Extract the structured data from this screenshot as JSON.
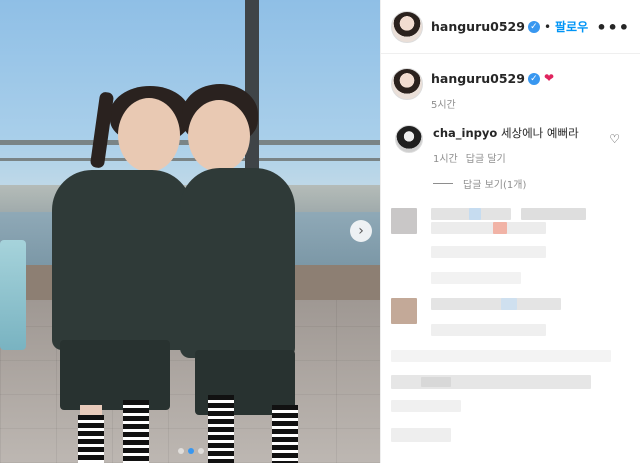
{
  "post": {
    "author": "hanguru0529",
    "follow_label": "팔로우",
    "more_label": "•••",
    "caption_username": "hanguru0529",
    "caption_emoji": "❤",
    "time_ago": "5시간"
  },
  "comment": {
    "username": "cha_inpyo",
    "text": "세상에나 예뻐라",
    "time_ago": "1시간",
    "reply_label": "답글 달기",
    "view_replies_label": "답글 보기(1개)"
  },
  "carousel": {
    "next_icon": "chevron-right-icon",
    "slide_count": 3,
    "active_slide": 2
  },
  "colors": {
    "verified": "#3897f0",
    "follow": "#0095f6",
    "heart": "#e0245e",
    "muted": "#8e8e8e"
  }
}
